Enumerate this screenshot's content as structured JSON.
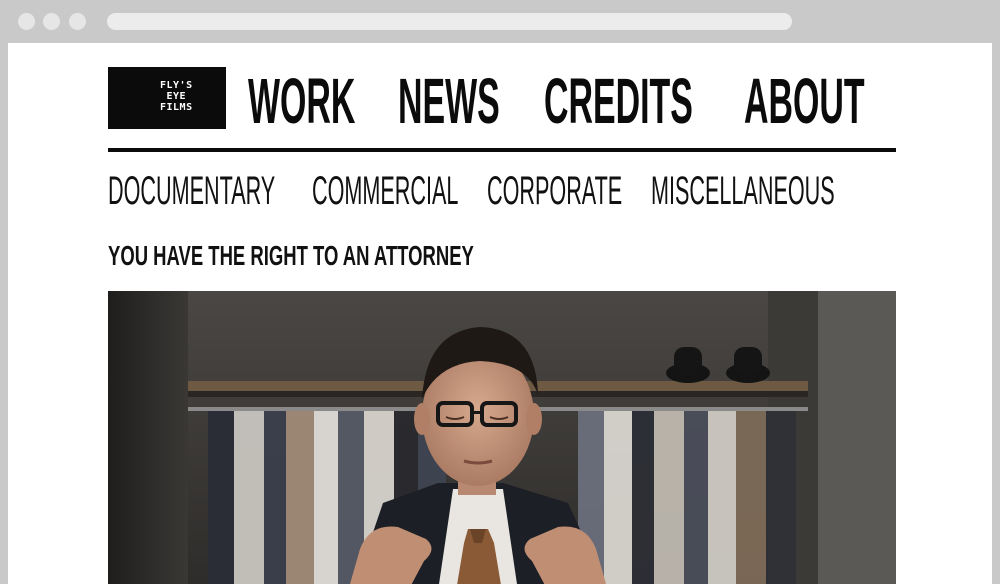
{
  "logo": {
    "text": "FLY'S\n EYE\nFILMS"
  },
  "nav": {
    "work": "WORK",
    "news": "NEWS",
    "credits": "CREDITS",
    "about": "ABOUT"
  },
  "categories": {
    "documentary": "DOCUMENTARY",
    "commercial": "COMMERCIAL",
    "corporate": "CORPORATE",
    "miscellaneous": "MISCELLANEOUS"
  },
  "post": {
    "title": "YOU HAVE THE RIGHT TO AN ATTORNEY"
  },
  "colors": {
    "chrome": "#c9c9c9",
    "page_background": "#ffffff",
    "ink": "#0b0b0b"
  }
}
